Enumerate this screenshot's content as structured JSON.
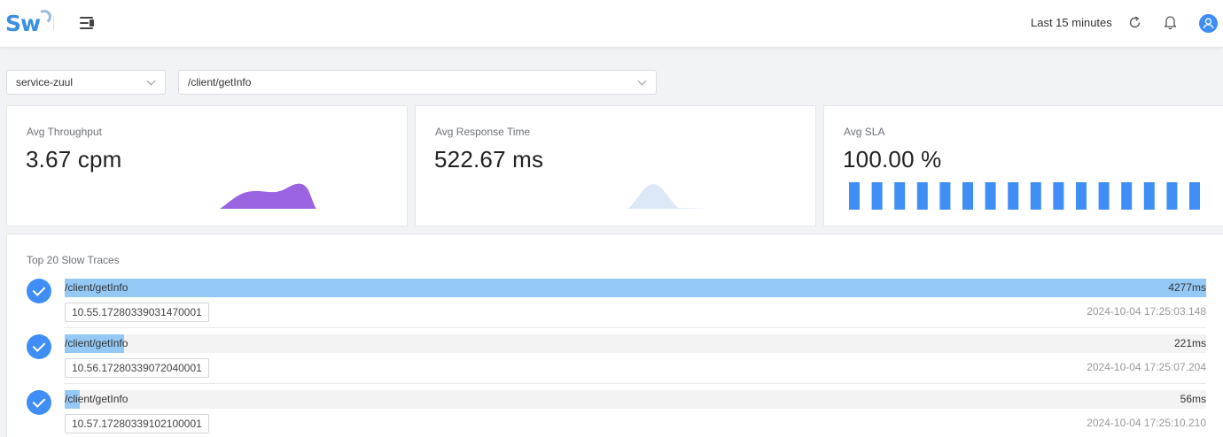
{
  "header": {
    "logo": "Sw",
    "time_range": "Last 15 minutes",
    "icons": [
      "menu-toggle-icon",
      "refresh-icon",
      "bell-icon",
      "user-icon"
    ]
  },
  "filters": {
    "service": "service-zuul",
    "endpoint": "/client/getInfo"
  },
  "metrics": {
    "throughput": {
      "title": "Avg Throughput",
      "value": "3.67 cpm",
      "color": "#9a63e0"
    },
    "response_time": {
      "title": "Avg Response Time",
      "value": "522.67 ms",
      "color": "#dde8f7"
    },
    "sla": {
      "title": "Avg SLA",
      "value": "100.00 %",
      "color": "#3f8ef5",
      "bar_count": 16
    }
  },
  "traces": {
    "title": "Top 20 Slow Traces",
    "items": [
      {
        "endpoint": "/client/getInfo",
        "duration": "4277ms",
        "trace_id": "10.55.17280339031470001",
        "time": "2024-10-04 17:25:03.148",
        "fraction": 1.0
      },
      {
        "endpoint": "/client/getInfo",
        "duration": "221ms",
        "trace_id": "10.56.17280339072040001",
        "time": "2024-10-04 17:25:07.204",
        "fraction": 0.052
      },
      {
        "endpoint": "/client/getInfo",
        "duration": "56ms",
        "trace_id": "10.57.17280339102100001",
        "time": "2024-10-04 17:25:10.210",
        "fraction": 0.013
      }
    ]
  },
  "colors": {
    "accent": "#3f8ef5",
    "trace_bar": "#95c9f5",
    "logo": "#3d8fe0"
  }
}
